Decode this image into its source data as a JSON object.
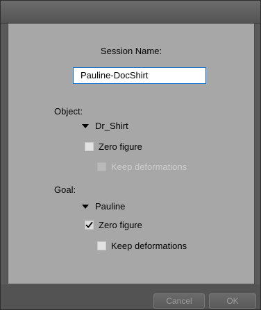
{
  "session": {
    "label": "Session Name:",
    "value": "Pauline-DocShirt"
  },
  "object": {
    "label": "Object:",
    "item": "Dr_Shirt",
    "zero_figure": {
      "label": "Zero figure",
      "checked": false,
      "enabled": true
    },
    "keep_deformations": {
      "label": "Keep deformations",
      "checked": false,
      "enabled": false
    }
  },
  "goal": {
    "label": "Goal:",
    "item": "Pauline",
    "zero_figure": {
      "label": "Zero figure",
      "checked": true,
      "enabled": true
    },
    "keep_deformations": {
      "label": "Keep deformations",
      "checked": false,
      "enabled": true
    }
  },
  "buttons": {
    "cancel": "Cancel",
    "ok": "OK"
  },
  "icons": {
    "expand": "triangle-down-icon",
    "check": "checkmark-icon"
  },
  "colors": {
    "panel": "#a7a7a7",
    "frame": "#5a5a5a",
    "input_border": "#0e6ec9"
  }
}
